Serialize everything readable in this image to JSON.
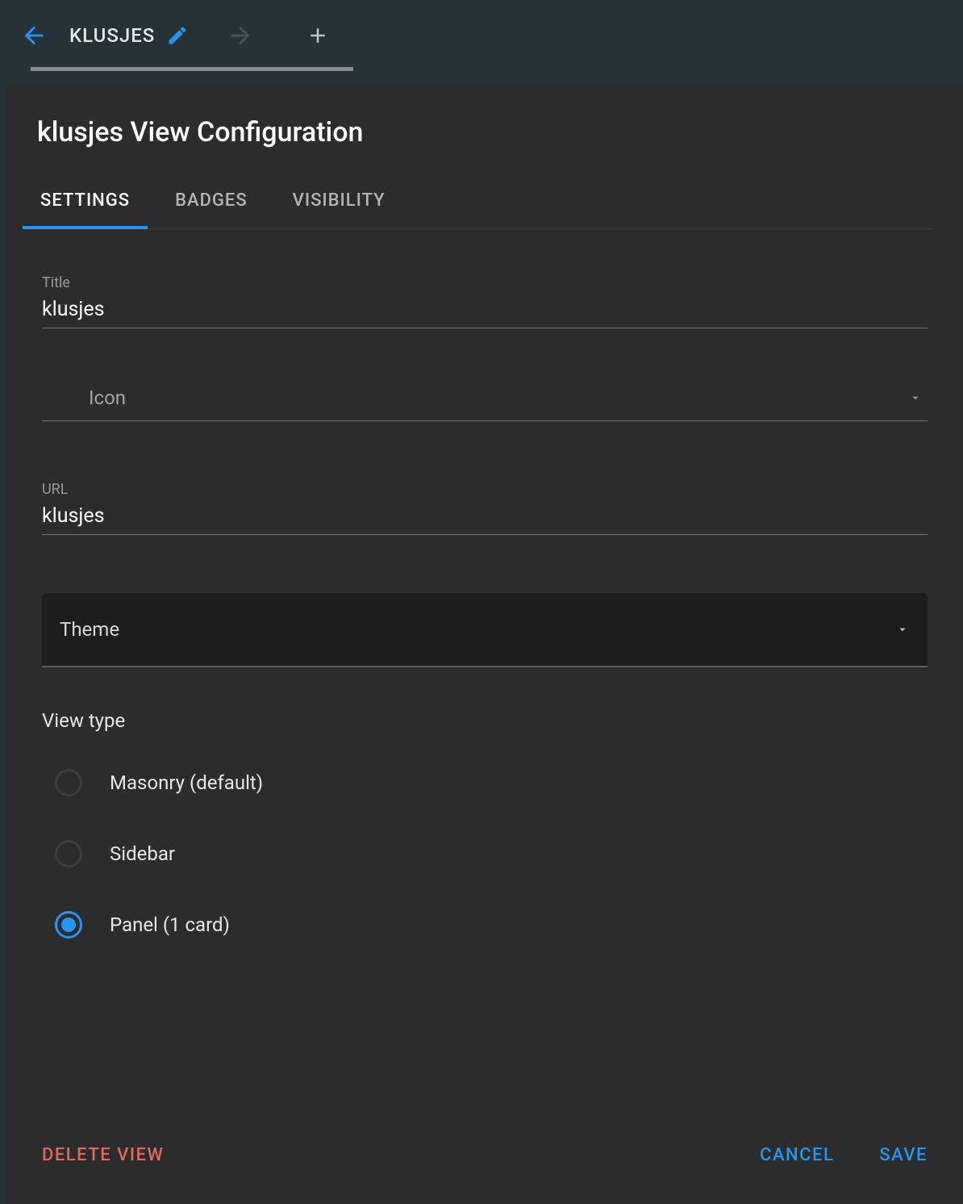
{
  "appbar": {
    "tab_label": "KLUSJES"
  },
  "dialog": {
    "title": "klusjes View Configuration",
    "tabs": {
      "settings": "SETTINGS",
      "badges": "BADGES",
      "visibility": "VISIBILITY"
    },
    "fields": {
      "title_label": "Title",
      "title_value": "klusjes",
      "icon_label": "Icon",
      "url_label": "URL",
      "url_value": "klusjes",
      "theme_label": "Theme"
    },
    "view_type": {
      "heading": "View type",
      "options": {
        "masonry": "Masonry (default)",
        "sidebar": "Sidebar",
        "panel": "Panel (1 card)"
      },
      "selected": "panel"
    },
    "actions": {
      "delete": "DELETE VIEW",
      "cancel": "CANCEL",
      "save": "SAVE"
    }
  }
}
